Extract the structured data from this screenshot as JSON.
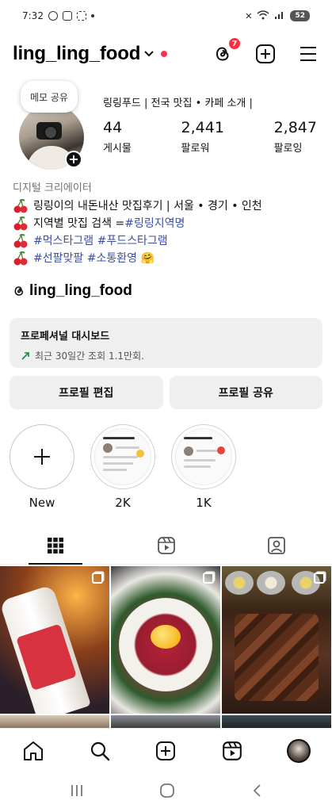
{
  "status_bar": {
    "time": "7:32",
    "battery": "52"
  },
  "header": {
    "username": "ling_ling_food",
    "threads_badge": "7",
    "accent": "#ff2e55"
  },
  "profile": {
    "note": "메모 공유",
    "name_line": "링링푸드 | 전국 맛집 • 카페 소개 |",
    "stats": [
      {
        "value": "44",
        "label": "게시물"
      },
      {
        "value": "2,441",
        "label": "팔로워"
      },
      {
        "value": "2,847",
        "label": "팔로잉"
      }
    ],
    "category": "디지털 크리에이터",
    "bio": {
      "line1": "링링이의 내돈내산 맛집후기 | 서울 • 경기 • 인천",
      "line2_text": "지역별 맛집 검색 = ",
      "line2_tag": "#링링지역명",
      "line3_tag1": "#먹스타그램",
      "line3_tag2": "#푸드스타그램",
      "line4_tag1": "#선팔맞팔",
      "line4_tag2": "#소통환영",
      "line4_emoji": "🤗"
    },
    "threads_handle": "ling_ling_food",
    "link_color": "#3b4fa3"
  },
  "dashboard": {
    "title": "프로페셔널 대시보드",
    "subtitle": "최근 30일간 조회 1.1만회."
  },
  "buttons": {
    "edit_profile": "프로필 편집",
    "share_profile": "프로필 공유"
  },
  "highlights": [
    {
      "label": "New"
    },
    {
      "label": "2K"
    },
    {
      "label": "1K"
    }
  ],
  "tabs": [
    {
      "name": "grid",
      "icon": "grid-icon"
    },
    {
      "name": "reels",
      "icon": "reels-icon"
    },
    {
      "name": "tagged",
      "icon": "tagged-icon"
    }
  ],
  "grid_posts": [
    {
      "name": "post-strawberry-drink"
    },
    {
      "name": "post-yukhoe"
    },
    {
      "name": "post-grilled-ribs"
    },
    {
      "name": "post-4"
    },
    {
      "name": "post-5"
    },
    {
      "name": "post-6"
    }
  ],
  "bottom_nav": [
    "home-icon",
    "search-icon",
    "create-icon",
    "reels-icon",
    "profile-avatar"
  ]
}
